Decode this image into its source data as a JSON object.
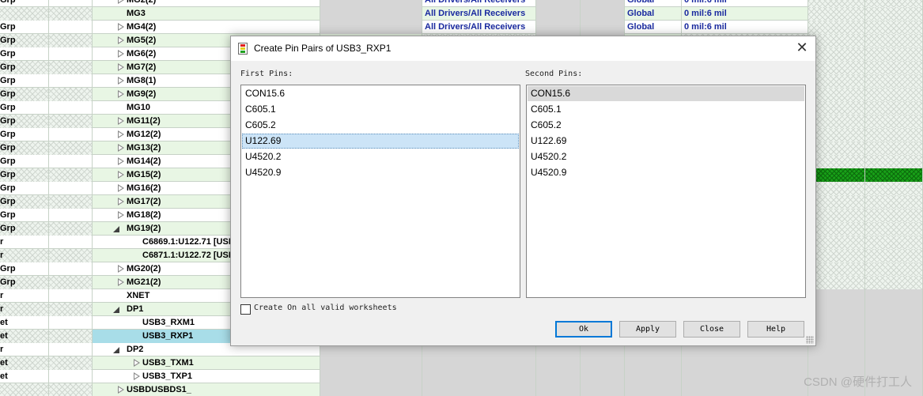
{
  "sheet": {
    "rows": [
      {
        "type": "Grp",
        "name": "MG2(2)",
        "level": 1,
        "expander": "closed",
        "alt": false,
        "c4": "All Drivers/All Receivers",
        "c7": "Global",
        "c8": "0 mil:6 mil"
      },
      {
        "type": "",
        "name": "MG3",
        "level": 1,
        "expander": "none",
        "alt": true,
        "c4": "All Drivers/All Receivers",
        "c7": "Global",
        "c8": "0 mil:6 mil"
      },
      {
        "type": "Grp",
        "name": "MG4(2)",
        "level": 1,
        "expander": "closed",
        "alt": false,
        "c4": "All Drivers/All Receivers",
        "c7": "Global",
        "c8": "0 mil:6 mil"
      },
      {
        "type": "Grp",
        "name": "MG5(2)",
        "level": 1,
        "expander": "closed",
        "alt": true
      },
      {
        "type": "Grp",
        "name": "MG6(2)",
        "level": 1,
        "expander": "closed",
        "alt": false
      },
      {
        "type": "Grp",
        "name": "MG7(2)",
        "level": 1,
        "expander": "closed",
        "alt": true
      },
      {
        "type": "Grp",
        "name": "MG8(1)",
        "level": 1,
        "expander": "closed",
        "alt": false
      },
      {
        "type": "Grp",
        "name": "MG9(2)",
        "level": 1,
        "expander": "closed",
        "alt": true
      },
      {
        "type": "Grp",
        "name": "MG10",
        "level": 1,
        "expander": "none",
        "alt": false
      },
      {
        "type": "Grp",
        "name": "MG11(2)",
        "level": 1,
        "expander": "closed",
        "alt": true
      },
      {
        "type": "Grp",
        "name": "MG12(2)",
        "level": 1,
        "expander": "closed",
        "alt": false
      },
      {
        "type": "Grp",
        "name": "MG13(2)",
        "level": 1,
        "expander": "closed",
        "alt": true
      },
      {
        "type": "Grp",
        "name": "MG14(2)",
        "level": 1,
        "expander": "closed",
        "alt": false
      },
      {
        "type": "Grp",
        "name": "MG15(2)",
        "level": 1,
        "expander": "closed",
        "alt": true,
        "green": true
      },
      {
        "type": "Grp",
        "name": "MG16(2)",
        "level": 1,
        "expander": "closed",
        "alt": false
      },
      {
        "type": "Grp",
        "name": "MG17(2)",
        "level": 1,
        "expander": "closed",
        "alt": true
      },
      {
        "type": "Grp",
        "name": "MG18(2)",
        "level": 1,
        "expander": "closed",
        "alt": false
      },
      {
        "type": "Grp",
        "name": "MG19(2)",
        "level": 1,
        "expander": "open",
        "alt": true
      },
      {
        "type": "r",
        "name": "C6869.1:U122.71 [USB",
        "level": 2,
        "expander": "none",
        "alt": false
      },
      {
        "type": "r",
        "name": "C6871.1:U122.72 [USB",
        "level": 2,
        "expander": "none",
        "alt": true
      },
      {
        "type": "Grp",
        "name": "MG20(2)",
        "level": 1,
        "expander": "closed",
        "alt": false
      },
      {
        "type": "Grp",
        "name": "MG21(2)",
        "level": 1,
        "expander": "closed",
        "alt": true
      },
      {
        "type": "r",
        "name": "XNET",
        "level": 1,
        "expander": "none",
        "alt": false,
        "grey": true
      },
      {
        "type": "r",
        "name": "DP1",
        "level": 1,
        "expander": "open",
        "alt": true,
        "grey": true
      },
      {
        "type": "et",
        "name": "USB3_RXM1",
        "level": 2,
        "expander": "none",
        "alt": false,
        "grey": true
      },
      {
        "type": "et",
        "name": "USB3_RXP1",
        "level": 2,
        "expander": "none",
        "alt": true,
        "selected": true,
        "grey": true
      },
      {
        "type": "r",
        "name": "DP2",
        "level": 1,
        "expander": "open",
        "alt": false,
        "grey": true
      },
      {
        "type": "et",
        "name": "USB3_TXM1",
        "level": 2,
        "expander": "closed",
        "alt": true,
        "grey": true
      },
      {
        "type": "et",
        "name": "USB3_TXP1",
        "level": 2,
        "expander": "closed",
        "alt": false,
        "grey": true
      },
      {
        "type": "",
        "name": "USBDUSBDS1_",
        "level": 1,
        "expander": "closed",
        "alt": true,
        "grey": true
      }
    ]
  },
  "dialog": {
    "title": "Create Pin Pairs of USB3_RXP1",
    "close_glyph": "✕",
    "first_label": "First Pins:",
    "second_label": "Second Pins:",
    "first_pins": [
      "CON15.6",
      "C605.1",
      "C605.2",
      "U122.69",
      "U4520.2",
      "U4520.9"
    ],
    "first_focused_index": 3,
    "second_pins": [
      "CON15.6",
      "C605.1",
      "C605.2",
      "U122.69",
      "U4520.2",
      "U4520.9"
    ],
    "second_selected_index": 0,
    "checkbox_label": "Create On all valid worksheets",
    "checkbox_checked": false,
    "buttons": {
      "ok": "Ok",
      "apply": "Apply",
      "close": "Close",
      "help": "Help"
    }
  },
  "watermark": "CSDN @硬件打工人"
}
